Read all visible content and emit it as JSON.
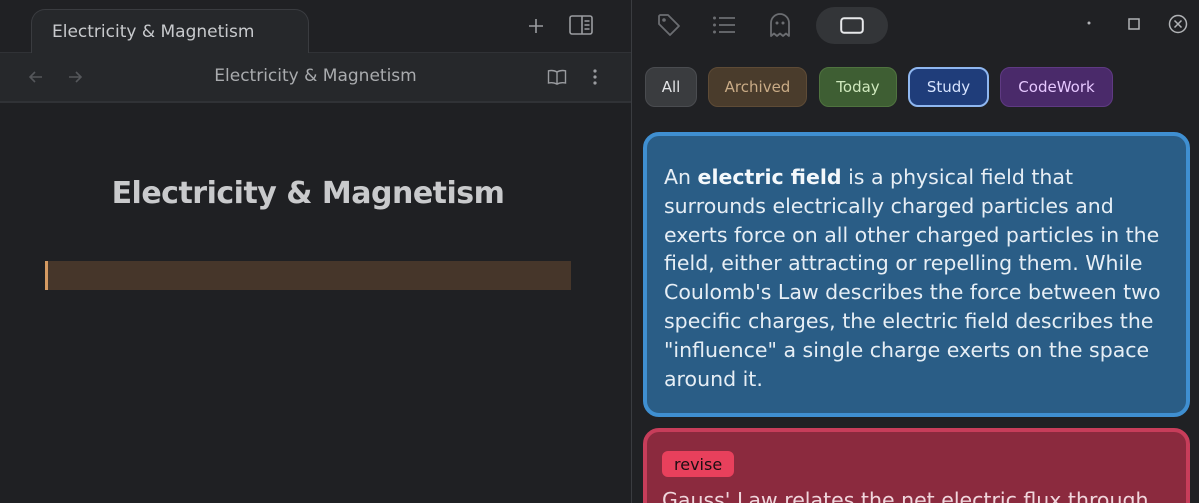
{
  "browser": {
    "tab_title": "Electricity & Magnetism",
    "nav_title": "Electricity & Magnetism",
    "icons": [
      "plus-icon",
      "sidebar-icon",
      "back-arrow-icon",
      "forward-arrow-icon",
      "reader-icon",
      "more-vert-icon"
    ]
  },
  "document": {
    "title": "Electricity & Magnetism"
  },
  "panel": {
    "icons": [
      "tag-icon",
      "list-icon",
      "ghost-icon",
      "card-view-icon",
      "minimize-icon",
      "maximize-icon",
      "close-icon"
    ],
    "filters": [
      {
        "label": "All"
      },
      {
        "label": "Archived"
      },
      {
        "label": "Today"
      },
      {
        "label": "Study"
      },
      {
        "label": "CodeWork"
      }
    ],
    "active_filter": "Study",
    "cards": [
      {
        "before": "An ",
        "bold": "electric field",
        "after": " is a physical field that surrounds electrically charged particles and exerts force on all other charged particles in the field, either attracting or repelling them. While Coulomb's Law describes the force between two specific charges, the electric field describes the \"influence\" a single charge exerts on the space around it.",
        "color": "#2a5d86"
      },
      {
        "tag": "revise",
        "text": "Gauss' Law relates the net electric flux through",
        "color": "#8b2a3e"
      }
    ]
  },
  "colors": {
    "accent_blue": "#3f8fd1",
    "accent_red": "#c73d5a",
    "highlight": "#d49a62"
  }
}
